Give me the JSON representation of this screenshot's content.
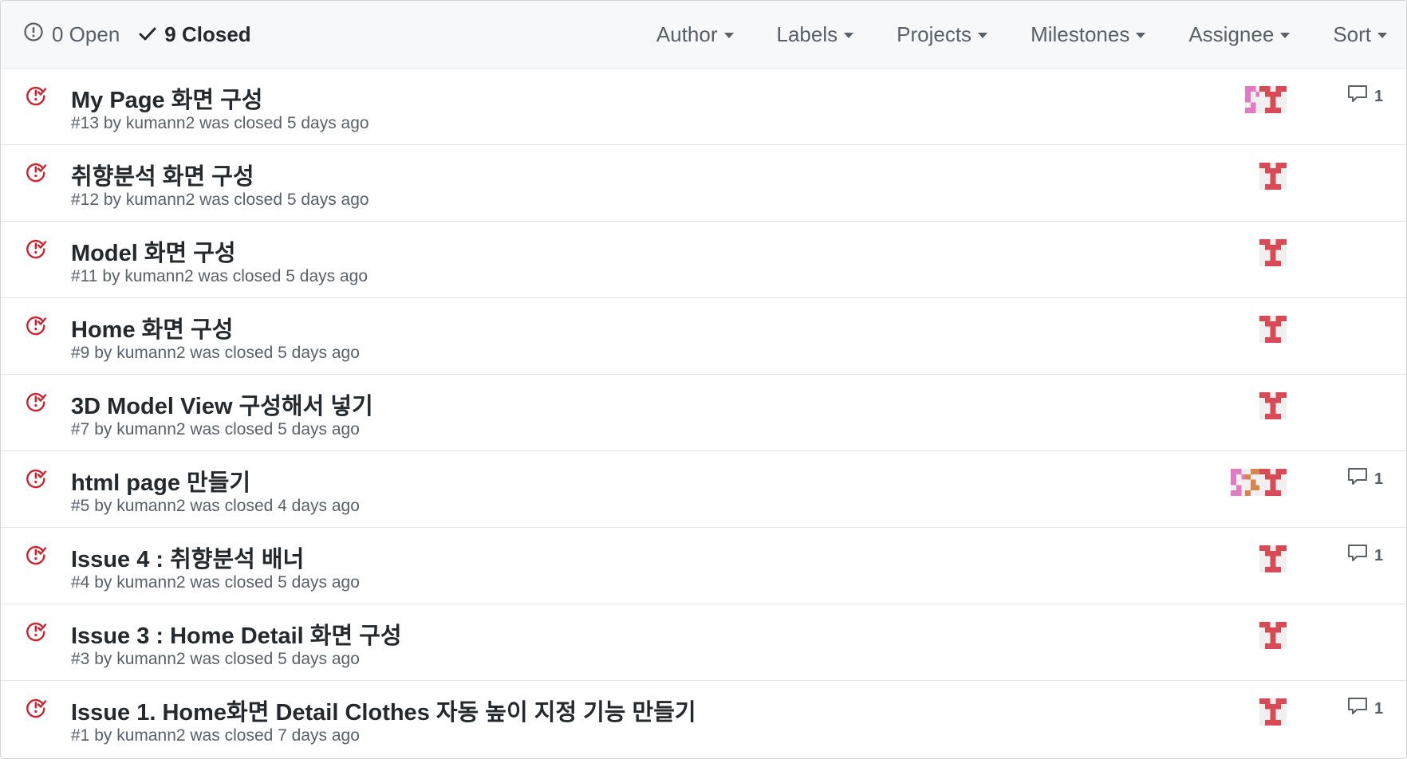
{
  "header": {
    "open_label": "0 Open",
    "closed_label": "9 Closed",
    "filters": [
      "Author",
      "Labels",
      "Projects",
      "Milestones",
      "Assignee",
      "Sort"
    ]
  },
  "colors": {
    "closed_icon": "#cb2431",
    "header_bg": "#f6f8fa",
    "border": "#e1e4e8",
    "muted_text": "#586069"
  },
  "issues": [
    {
      "title": "My Page 화면 구성",
      "meta": "#13 by kumann2 was closed 5 days ago",
      "comments": "1",
      "avatars": [
        "pink-identicon",
        "red-identicon"
      ]
    },
    {
      "title": "취향분석 화면 구성",
      "meta": "#12 by kumann2 was closed 5 days ago",
      "comments": "",
      "avatars": [
        "red-identicon"
      ]
    },
    {
      "title": "Model 화면 구성",
      "meta": "#11 by kumann2 was closed 5 days ago",
      "comments": "",
      "avatars": [
        "red-identicon"
      ]
    },
    {
      "title": "Home 화면 구성",
      "meta": "#9 by kumann2 was closed 5 days ago",
      "comments": "",
      "avatars": [
        "red-identicon"
      ]
    },
    {
      "title": "3D Model View 구성해서 넣기",
      "meta": "#7 by kumann2 was closed 5 days ago",
      "comments": "",
      "avatars": [
        "red-identicon"
      ]
    },
    {
      "title": "html page 만들기",
      "meta": "#5 by kumann2 was closed 4 days ago",
      "comments": "1",
      "avatars": [
        "pink-identicon",
        "orange-identicon",
        "red-identicon"
      ]
    },
    {
      "title": "Issue 4 : 취향분석 배너",
      "meta": "#4 by kumann2 was closed 5 days ago",
      "comments": "1",
      "avatars": [
        "red-identicon"
      ]
    },
    {
      "title": "Issue 3 : Home Detail 화면 구성",
      "meta": "#3 by kumann2 was closed 5 days ago",
      "comments": "",
      "avatars": [
        "red-identicon"
      ]
    },
    {
      "title": "Issue 1. Home화면 Detail Clothes 자동 높이 지정 기능 만들기",
      "meta": "#1 by kumann2 was closed 7 days ago",
      "comments": "1",
      "avatars": [
        "red-identicon"
      ]
    }
  ]
}
